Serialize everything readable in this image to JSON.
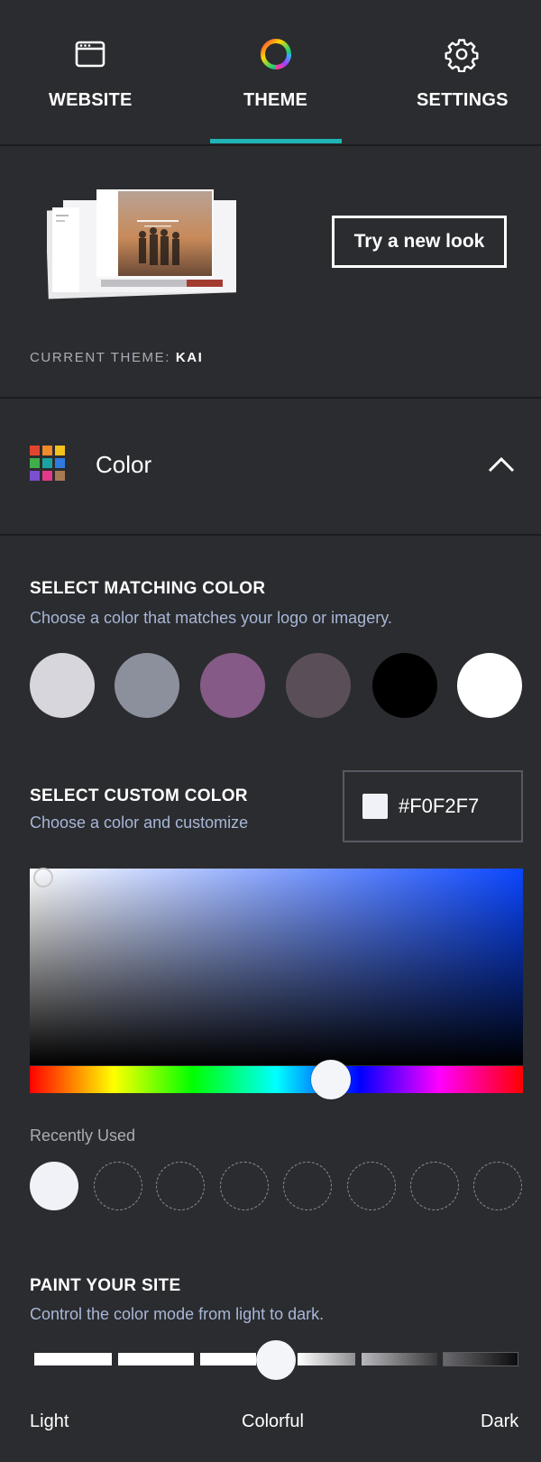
{
  "tabs": [
    {
      "label": "WEBSITE",
      "icon": "browser-window-icon"
    },
    {
      "label": "THEME",
      "icon": "theme-ring-icon",
      "active": true
    },
    {
      "label": "SETTINGS",
      "icon": "gear-icon"
    }
  ],
  "theme": {
    "try_button": "Try a new look",
    "current_label": "CURRENT THEME:",
    "current_name": "KAI"
  },
  "color_section": {
    "title": "Color",
    "icon": "color-palette-icon",
    "expanded": true
  },
  "matching": {
    "title": "SELECT MATCHING COLOR",
    "subtitle": "Choose a color that matches your logo or imagery.",
    "swatches": [
      "#d6d6dc",
      "#8c909c",
      "#855a86",
      "#5a4f58",
      "#000000",
      "#ffffff"
    ]
  },
  "custom": {
    "title": "SELECT CUSTOM COLOR",
    "subtitle": "Choose a color and customize",
    "hex_value": "#F0F2F7"
  },
  "picker": {
    "hue_color": "#0a46ff"
  },
  "recent": {
    "label": "Recently Used",
    "colors": [
      "#f0f2f7",
      null,
      null,
      null,
      null,
      null,
      null,
      null
    ]
  },
  "paint": {
    "title": "PAINT YOUR SITE",
    "subtitle": "Control the color mode from light to dark.",
    "labels": [
      "Light",
      "Colorful",
      "Dark"
    ],
    "selected": "Colorful"
  },
  "colors": {
    "background": "#2b2c2f",
    "accent": "#1fb5b6",
    "subtitle": "#a7b7d8"
  }
}
